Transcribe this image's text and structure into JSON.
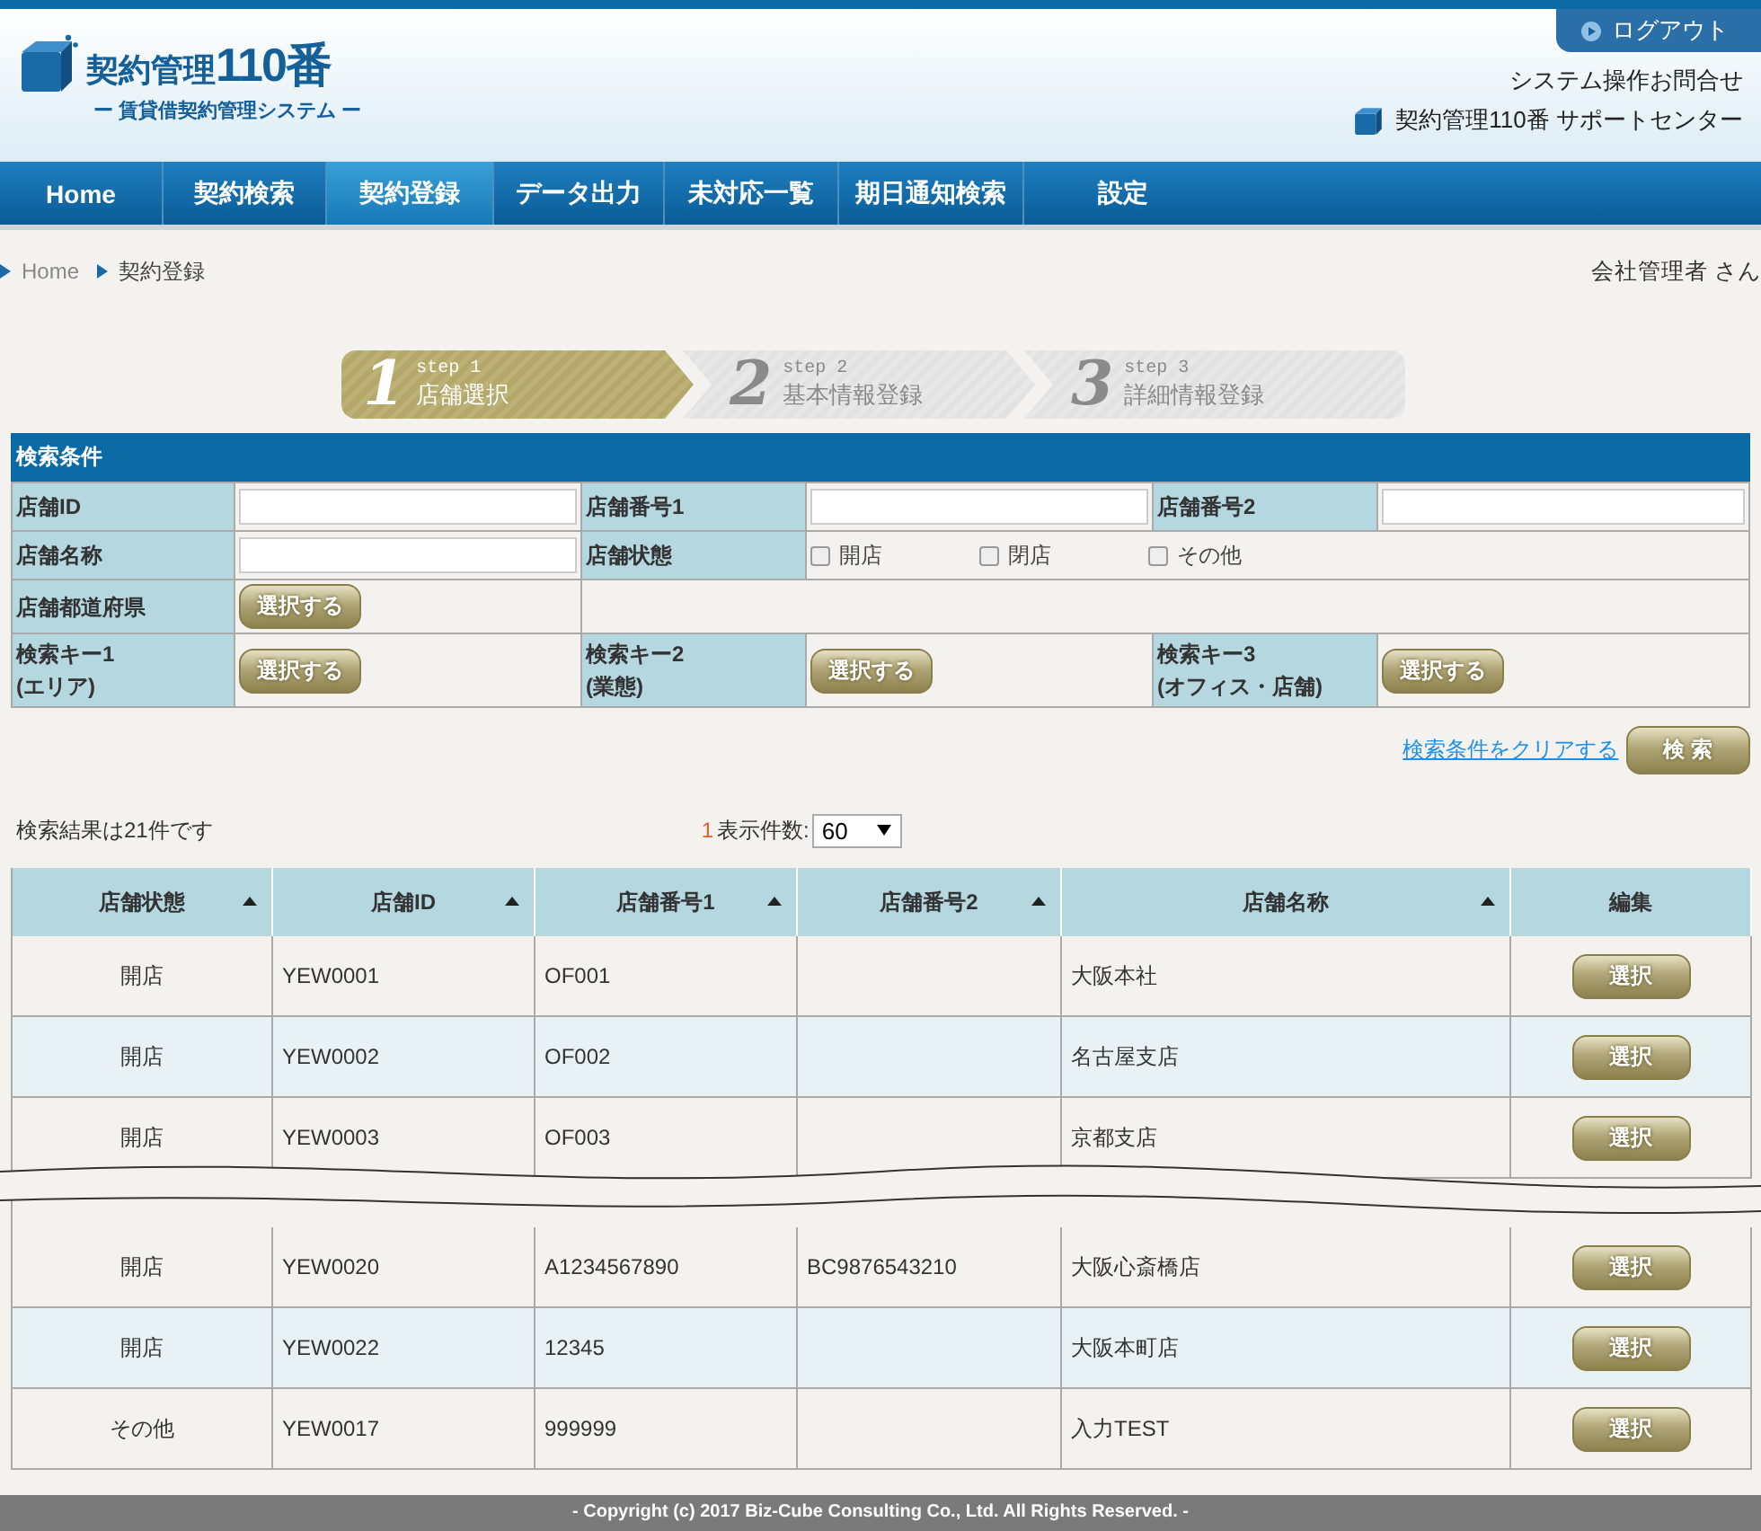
{
  "header": {
    "logo_title": "契約管理",
    "logo_number": "110番",
    "logo_subtitle": "ー 賃貸借契約管理システム ー",
    "logout": "ログアウト",
    "inquiry": "システム操作お問合せ",
    "support": "契約管理110番 サポートセンター"
  },
  "nav": [
    {
      "label": "Home",
      "selected": false
    },
    {
      "label": "契約検索",
      "selected": false
    },
    {
      "label": "契約登録",
      "selected": true
    },
    {
      "label": "データ出力",
      "selected": false
    },
    {
      "label": "未対応一覧",
      "selected": false
    },
    {
      "label": "期日通知検索",
      "selected": false
    },
    {
      "label": "設定",
      "selected": false
    }
  ],
  "breadcrumb": [
    "Home",
    "契約登録"
  ],
  "user": "会社管理者 さん",
  "steps": [
    {
      "number": "1",
      "step": "step 1",
      "label": "店舗選択",
      "selected": true
    },
    {
      "number": "2",
      "step": "step 2",
      "label": "基本情報登録",
      "selected": false
    },
    {
      "number": "3",
      "step": "step 3",
      "label": "詳細情報登録",
      "selected": false
    }
  ],
  "search": {
    "title": "検索条件",
    "rows": [
      [
        {
          "label": [
            "店舗ID"
          ],
          "kind": "input"
        },
        {
          "label": [
            "店舗番号1"
          ],
          "kind": "input"
        },
        {
          "label": [
            "店舗番号2"
          ],
          "kind": "input"
        }
      ],
      [
        {
          "label": [
            "店舗名称"
          ],
          "kind": "input"
        },
        {
          "label": [
            "店舗状態"
          ],
          "kind": "checks",
          "options": [
            {
              "label": "開店",
              "checked": false
            },
            {
              "label": "閉店",
              "checked": false
            },
            {
              "label": "その他",
              "checked": false
            }
          ]
        }
      ],
      [
        {
          "label": [
            "店舗都道府県"
          ],
          "kind": "button",
          "button": "選択する"
        }
      ],
      [
        {
          "label": [
            "検索キー1",
            "(エリア)"
          ],
          "kind": "button",
          "button": "選択する"
        },
        {
          "label": [
            "検索キー2",
            "(業態)"
          ],
          "kind": "button",
          "button": "選択する"
        },
        {
          "label": [
            "検索キー3",
            "(オフィス・店舗)"
          ],
          "kind": "button",
          "button": "選択する"
        }
      ]
    ],
    "clear_link": "検索条件をクリアする",
    "search_button": "検 索"
  },
  "results": {
    "count": "検索結果は21件です",
    "page": "1",
    "per_page_label": "表示件数:",
    "per_page": "60",
    "columns": [
      {
        "label": "店舗状態",
        "sortable": true
      },
      {
        "label": "店舗ID",
        "sortable": true
      },
      {
        "label": "店舗番号1",
        "sortable": true
      },
      {
        "label": "店舗番号2",
        "sortable": true
      },
      {
        "label": "店舗名称",
        "sortable": true
      },
      {
        "label": "編集",
        "sortable": false
      }
    ],
    "rows_before_break": [
      {
        "status": "開店",
        "id": "YEW0001",
        "number1": "OF001",
        "name": "大阪本社",
        "button": "選択"
      },
      {
        "status": "開店",
        "id": "YEW0002",
        "number1": "OF002",
        "name": "名古屋支店",
        "button": "選択"
      },
      {
        "status": "開店",
        "id": "YEW0003",
        "number1": "OF003",
        "name": "京都支店",
        "button": "選択"
      }
    ],
    "rows_after_break": [
      {
        "status": "開店",
        "id": "YEW0020",
        "number1": "A1234567890",
        "number2": "BC9876543210",
        "name": "大阪心斎橋店",
        "button": "選択"
      },
      {
        "status": "開店",
        "id": "YEW0022",
        "number1": "12345",
        "name": "大阪本町店",
        "button": "選択"
      },
      {
        "status": "その他",
        "id": "YEW0017",
        "number1": "999999",
        "name": "入力TEST",
        "button": "選択"
      }
    ]
  },
  "footer": "- Copyright (c) 2017 Biz-Cube Consulting Co., Ltd. All Rights Reserved. -"
}
